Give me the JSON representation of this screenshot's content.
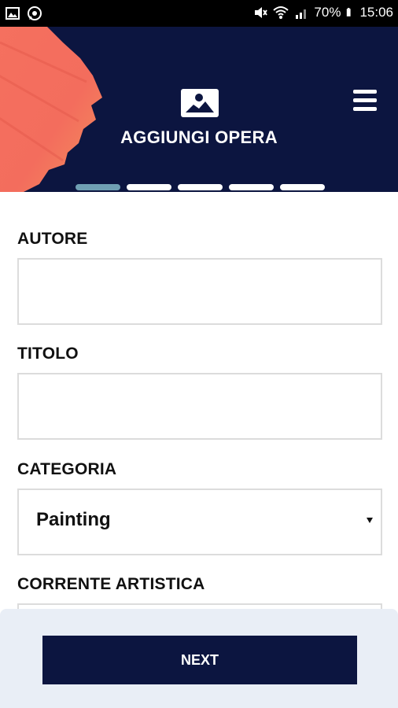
{
  "status_bar": {
    "battery": "70%",
    "time": "15:06",
    "icons": [
      "image-icon",
      "whatsapp-icon",
      "mute-icon",
      "wifi-icon",
      "signal-icon",
      "battery-icon"
    ]
  },
  "header": {
    "title": "AGGIUNGI OPERA",
    "icon": "image-icon",
    "menu_icon": "hamburger-menu-icon",
    "steps_total": 5,
    "active_step": 1,
    "colors": {
      "background": "#0c1540",
      "accent": "#6f9fb3",
      "paint": "#f26b5b"
    }
  },
  "form": {
    "autore": {
      "label": "AUTORE",
      "value": ""
    },
    "titolo": {
      "label": "TITOLO",
      "value": ""
    },
    "categoria": {
      "label": "CATEGORIA",
      "value": "Painting"
    },
    "corrente": {
      "label": "CORRENTE ARTISTICA",
      "value": ""
    }
  },
  "footer": {
    "next_label": "NEXT"
  }
}
